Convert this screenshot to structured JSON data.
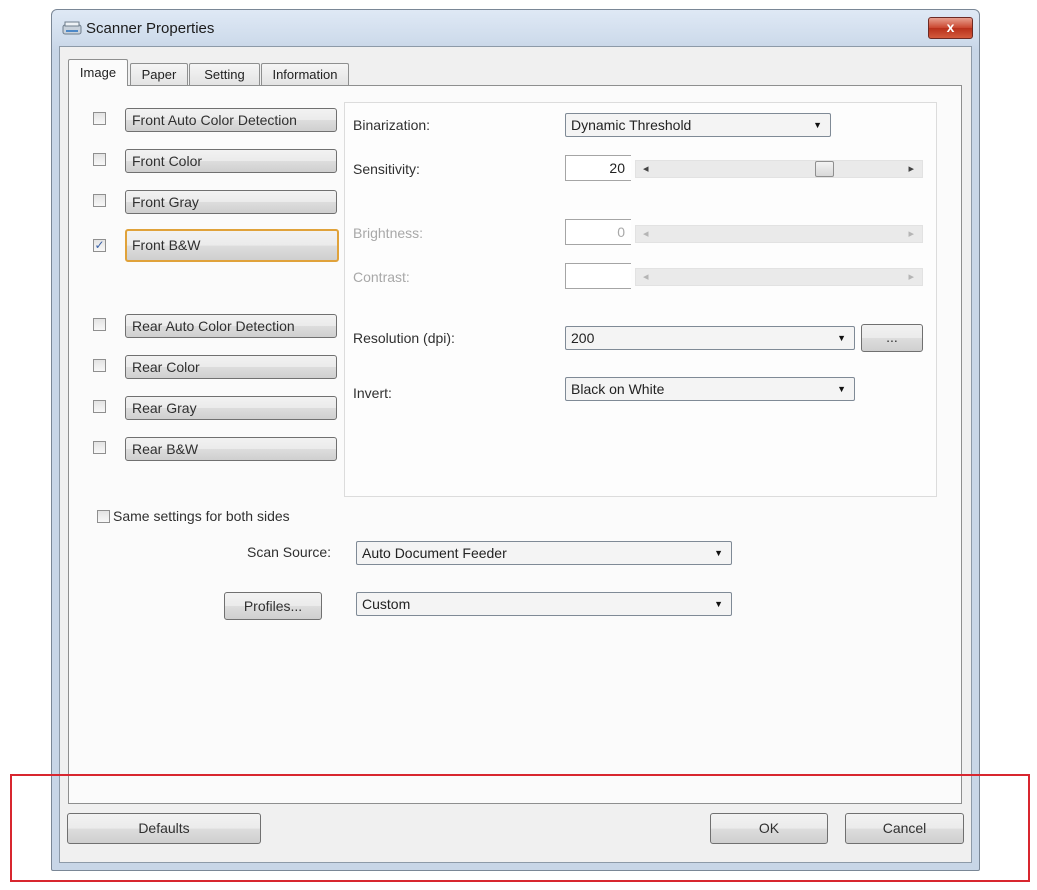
{
  "window": {
    "title": "Scanner Properties",
    "close_label": "x"
  },
  "tabs": [
    {
      "label": "Image",
      "active": true
    },
    {
      "label": "Paper",
      "active": false
    },
    {
      "label": "Setting",
      "active": false
    },
    {
      "label": "Information",
      "active": false
    }
  ],
  "image_types": [
    {
      "label": "Front Auto Color Detection",
      "checked": false,
      "selected": false
    },
    {
      "label": "Front Color",
      "checked": false,
      "selected": false
    },
    {
      "label": "Front Gray",
      "checked": false,
      "selected": false
    },
    {
      "label": "Front B&W",
      "checked": true,
      "selected": true
    },
    {
      "label": "Rear Auto Color Detection",
      "checked": false,
      "selected": false
    },
    {
      "label": "Rear Color",
      "checked": false,
      "selected": false
    },
    {
      "label": "Rear Gray",
      "checked": false,
      "selected": false
    },
    {
      "label": "Rear B&W",
      "checked": false,
      "selected": false
    }
  ],
  "settings": {
    "binarization_label": "Binarization:",
    "binarization_value": "Dynamic Threshold",
    "sensitivity_label": "Sensitivity:",
    "sensitivity_value": "20",
    "sensitivity_level": 0.7,
    "brightness_label": "Brightness:",
    "brightness_value": "0",
    "contrast_label": "Contrast:",
    "contrast_value": "",
    "resolution_label": "Resolution (dpi):",
    "resolution_value": "200",
    "resolution_more_label": "...",
    "invert_label": "Invert:",
    "invert_value": "Black on White"
  },
  "same_settings": {
    "label": "Same settings for both sides",
    "checked": false
  },
  "scan_source": {
    "label": "Scan Source:",
    "value": "Auto Document Feeder"
  },
  "profiles": {
    "button_label": "Profiles...",
    "value": "Custom"
  },
  "footer": {
    "defaults_label": "Defaults",
    "ok_label": "OK",
    "cancel_label": "Cancel"
  },
  "colors": {
    "selected_border": "#e0a23a",
    "highlight_box": "#d8262f",
    "close_button": "#c9452e"
  },
  "icons": {
    "app": "scanner-icon",
    "dropdown": "chevron-down-icon",
    "check": "checkmark-icon"
  }
}
